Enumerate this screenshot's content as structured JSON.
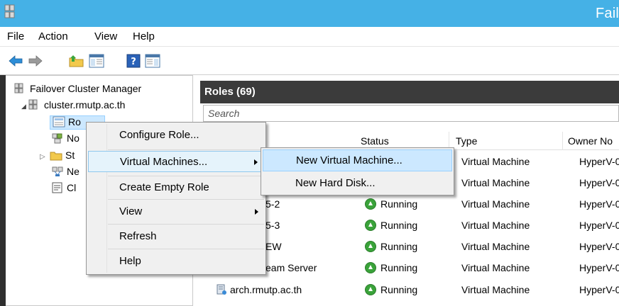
{
  "window": {
    "title": "Fail"
  },
  "menubar": {
    "items": [
      "File",
      "Action",
      "View",
      "Help"
    ]
  },
  "toolbar": {
    "icons": [
      "back-arrow-icon",
      "forward-arrow-icon",
      "up-folder-icon",
      "show-hide-tree-icon",
      "help-icon",
      "show-hide-action-pane-icon"
    ]
  },
  "tree": {
    "root": "Failover Cluster Manager",
    "cluster": "cluster.rmutp.ac.th",
    "children": [
      "Ro",
      "No",
      "St",
      "Ne",
      "Cl"
    ]
  },
  "roles_panel": {
    "title": "Roles (69)",
    "search_placeholder": "Search",
    "columns": [
      "Status",
      "Type",
      "Owner No"
    ],
    "rows": [
      {
        "name": "",
        "status": "",
        "type": "Virtual Machine",
        "owner": "HyperV-0"
      },
      {
        "name": "",
        "status": "",
        "type": "Virtual Machine",
        "owner": "HyperV-0"
      },
      {
        "name": "5-2",
        "status": "Running",
        "type": "Virtual Machine",
        "owner": "HyperV-0"
      },
      {
        "name": "5-3",
        "status": "Running",
        "type": "Virtual Machine",
        "owner": "HyperV-0"
      },
      {
        "name": "EW",
        "status": "Running",
        "type": "Virtual Machine",
        "owner": "HyperV-0"
      },
      {
        "name": "eam Server",
        "status": "Running",
        "type": "Virtual Machine",
        "owner": "HyperV-0"
      },
      {
        "name": "arch.rmutp.ac.th",
        "status": "Running",
        "type": "Virtual Machine",
        "owner": "HyperV-0"
      }
    ]
  },
  "context_menu": {
    "items": [
      "Configure Role...",
      "Virtual Machines...",
      "Create Empty Role",
      "View",
      "Refresh",
      "Help"
    ]
  },
  "submenu": {
    "items": [
      "New Virtual Machine...",
      "New Hard Disk..."
    ]
  },
  "colors": {
    "titlebar": "#45b1e6",
    "header_dark": "#3b3b3b",
    "highlight": "#cce8ff",
    "running_green": "#3aa33a"
  }
}
